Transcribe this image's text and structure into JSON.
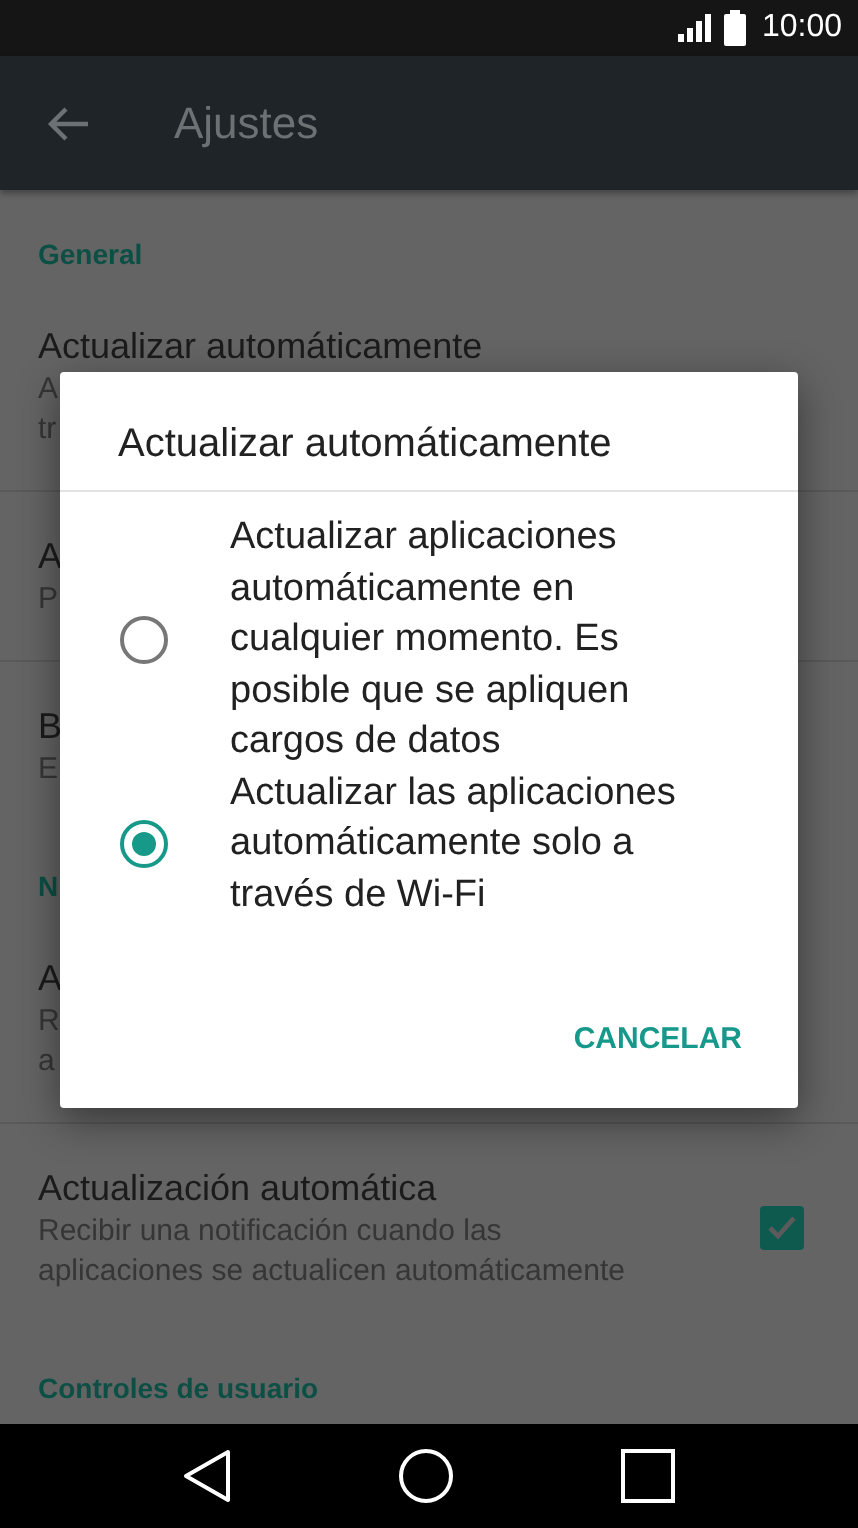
{
  "status_bar": {
    "time": "10:00"
  },
  "app_bar": {
    "title": "Ajustes"
  },
  "settings": [
    {
      "kind": "header",
      "title": "General"
    },
    {
      "kind": "item",
      "title": "Actualizar automáticamente",
      "subtitle": [
        "A",
        "tr"
      ]
    },
    {
      "kind": "item",
      "title": "A",
      "subtitle": [
        "P"
      ]
    },
    {
      "kind": "item",
      "title": "B",
      "subtitle": [
        "E"
      ]
    },
    {
      "kind": "header",
      "title": "N"
    },
    {
      "kind": "item",
      "title": "A",
      "subtitle": [
        "R",
        "a"
      ]
    },
    {
      "kind": "item",
      "title": "Actualización automática",
      "subtitle": [
        "Recibir una notificación cuando las",
        "aplicaciones se actualicen automáticamente"
      ],
      "checked": true
    },
    {
      "kind": "header",
      "title": "Controles de usuario"
    }
  ],
  "dialog": {
    "title": "Actualizar automáticamente",
    "options": [
      {
        "label": "Actualizar aplicaciones automáticamente en cualquier momento. Es posible que se apliquen cargos de datos",
        "selected": false
      },
      {
        "label": "Actualizar las aplicaciones automáticamente solo a través de Wi-Fi",
        "selected": true
      }
    ],
    "button": "CANCELAR"
  }
}
